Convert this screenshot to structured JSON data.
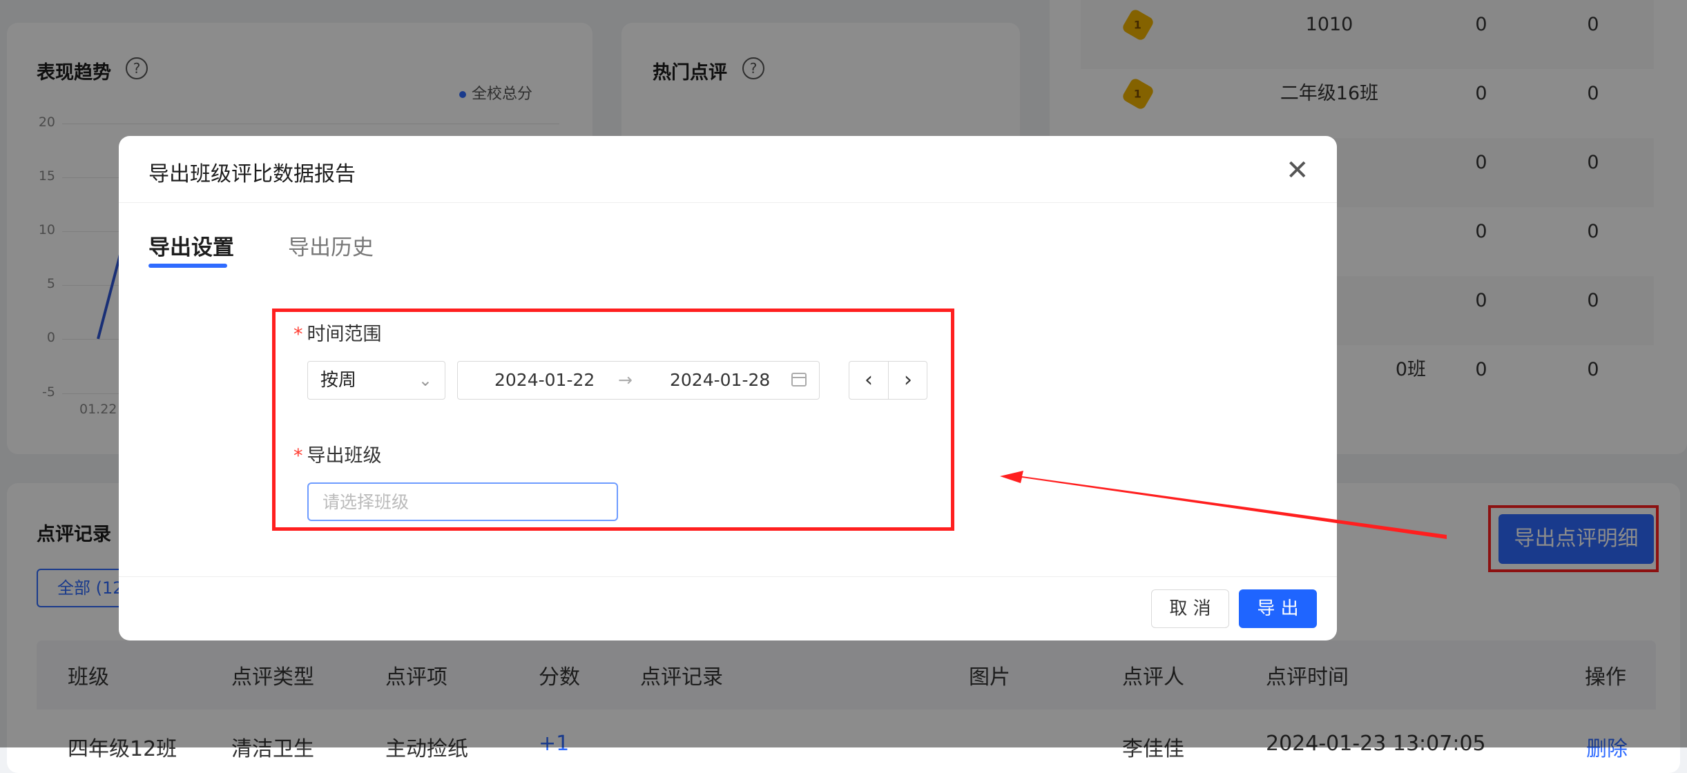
{
  "trend": {
    "title": "表现趋势",
    "legend": "全校总分",
    "y_ticks": [
      "20",
      "15",
      "10",
      "5",
      "0",
      "-5"
    ],
    "x_first_label": "01.22"
  },
  "hot": {
    "title": "热门点评"
  },
  "ranking": {
    "rows": [
      {
        "rank": "1",
        "name": "1010",
        "v1": "0",
        "v2": "0"
      },
      {
        "rank": "1",
        "name": "二年级16班",
        "v1": "0",
        "v2": "0"
      },
      {
        "rank": "",
        "name": "",
        "v1": "0",
        "v2": "0"
      },
      {
        "rank": "",
        "name": "",
        "v1": "0",
        "v2": "0"
      },
      {
        "rank": "",
        "name": "",
        "v1": "0",
        "v2": "0"
      },
      {
        "rank": "",
        "name": "0班",
        "v1": "0",
        "v2": "0"
      }
    ]
  },
  "records": {
    "title": "点评记录",
    "filter_all": "全部 (12",
    "export_detail": "导出点评明细",
    "columns": [
      "班级",
      "点评类型",
      "点评项",
      "分数",
      "点评记录",
      "图片",
      "点评人",
      "点评时间",
      "操作"
    ],
    "row_partial": [
      "四年级12班",
      "清洁卫生",
      "主动捡纸",
      "+1",
      "李佳佳",
      "2024-01-23 13:07:05",
      "删除"
    ]
  },
  "modal": {
    "title": "导出班级评比数据报告",
    "tabs": [
      "导出设置",
      "导出历史"
    ],
    "time_label": "时间范围",
    "period_select": "按周",
    "date_start": "2024-01-22",
    "date_end": "2024-01-28",
    "range_arrow": "→",
    "class_label": "导出班级",
    "class_placeholder": "请选择班级",
    "cancel": "取 消",
    "export": "导 出",
    "required_mark": "*"
  }
}
